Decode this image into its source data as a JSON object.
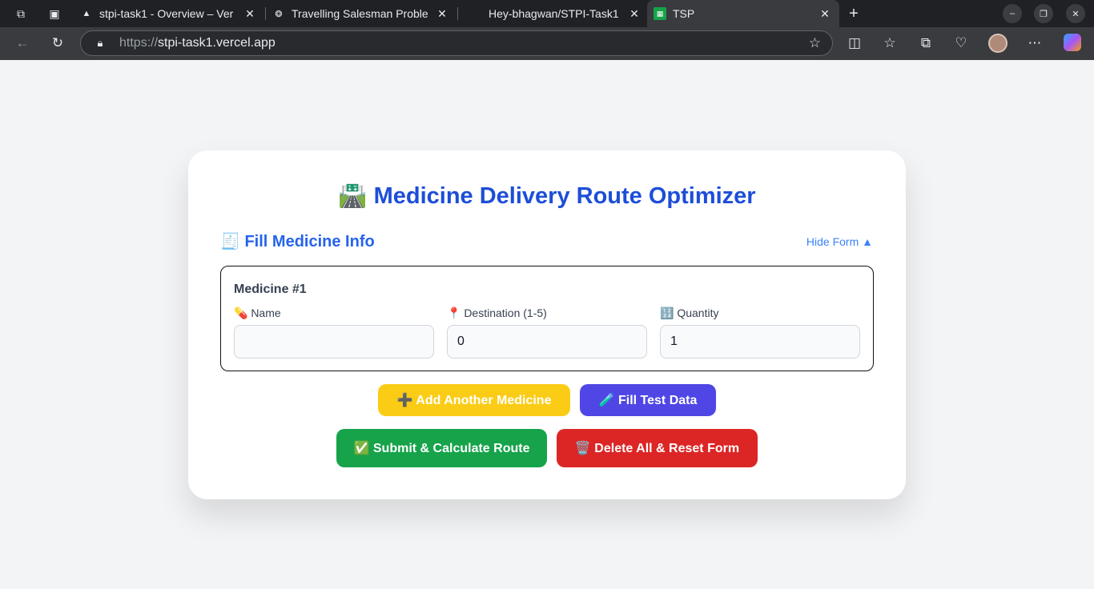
{
  "browser": {
    "tabs": [
      {
        "title": "stpi-task1 - Overview – Ver",
        "icon": "vercel-icon"
      },
      {
        "title": "Travelling Salesman Proble",
        "icon": "openai-icon"
      },
      {
        "title": "Hey-bhagwan/STPI-Task1",
        "icon": "github-icon"
      },
      {
        "title": "TSP",
        "icon": "tsp-favicon"
      }
    ],
    "url_protocol": "https://",
    "url_host": "stpi-task1.vercel.app"
  },
  "page": {
    "title_emoji": "🛣️",
    "title": "Medicine Delivery Route Optimizer",
    "section_emoji": "🧾",
    "section_title": "Fill Medicine Info",
    "hide_form": "Hide Form ▲",
    "medicine": {
      "heading": "Medicine #1",
      "name_label": "💊 Name",
      "name_value": "",
      "destination_label": "📍 Destination (1-5)",
      "destination_value": "0",
      "quantity_label": "🔢 Quantity",
      "quantity_value": "1"
    },
    "buttons": {
      "add": "➕ Add Another Medicine",
      "fill": "🧪 Fill Test Data",
      "submit": "✅ Submit & Calculate Route",
      "reset": "🗑️ Delete All & Reset Form"
    }
  },
  "colors": {
    "title": "#1d4ed8",
    "add": "#facc15",
    "fill": "#4f46e5",
    "submit": "#16a34a",
    "reset": "#dc2626"
  }
}
